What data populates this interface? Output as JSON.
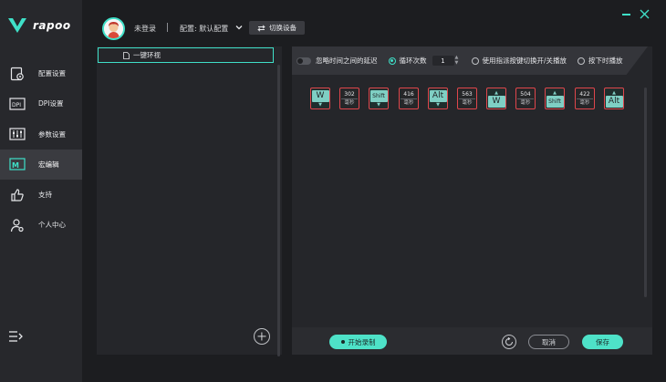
{
  "brand": {
    "logo_text": "rapoo",
    "accent_color": "#3fe0c8",
    "alert_color": "#e0464c"
  },
  "sidebar": {
    "items": [
      {
        "label": "配置设置",
        "icon": "config-gear-icon",
        "active": false
      },
      {
        "label": "DPI设置",
        "icon": "dpi-icon",
        "active": false
      },
      {
        "label": "参数设置",
        "icon": "sliders-icon",
        "active": false
      },
      {
        "label": "宏编辑",
        "icon": "macro-icon",
        "active": true
      },
      {
        "label": "支持",
        "icon": "thumbs-up-icon",
        "active": false
      },
      {
        "label": "个人中心",
        "icon": "user-gear-icon",
        "active": false
      }
    ],
    "collapse_icon": "menu-expand-icon"
  },
  "header": {
    "login_status": "未登录",
    "profile_label": "配置: 默认配置",
    "switch_device_label": "切换设备"
  },
  "macros": {
    "items": [
      {
        "label": "一键环视"
      }
    ]
  },
  "options": {
    "ignore_delay_label": "忽略时间之间的延迟",
    "loop_label": "循环次数",
    "loop_count": "1",
    "toggle_label": "使用指派按键切换开/关播放",
    "hold_label": "按下时播放"
  },
  "events": [
    {
      "type": "key",
      "key": "W",
      "dir": "down"
    },
    {
      "type": "delay",
      "value": "302",
      "unit": "毫秒"
    },
    {
      "type": "key",
      "key": "Shift",
      "dir": "down"
    },
    {
      "type": "delay",
      "value": "416",
      "unit": "毫秒"
    },
    {
      "type": "key",
      "key": "Alt",
      "dir": "down"
    },
    {
      "type": "delay",
      "value": "563",
      "unit": "毫秒"
    },
    {
      "type": "key",
      "key": "W",
      "dir": "up"
    },
    {
      "type": "delay",
      "value": "504",
      "unit": "毫秒"
    },
    {
      "type": "key",
      "key": "Shift",
      "dir": "up"
    },
    {
      "type": "delay",
      "value": "422",
      "unit": "毫秒"
    },
    {
      "type": "key",
      "key": "Alt",
      "dir": "up"
    }
  ],
  "footer": {
    "record_label": "开始录制",
    "cancel_label": "取消",
    "save_label": "保存"
  }
}
